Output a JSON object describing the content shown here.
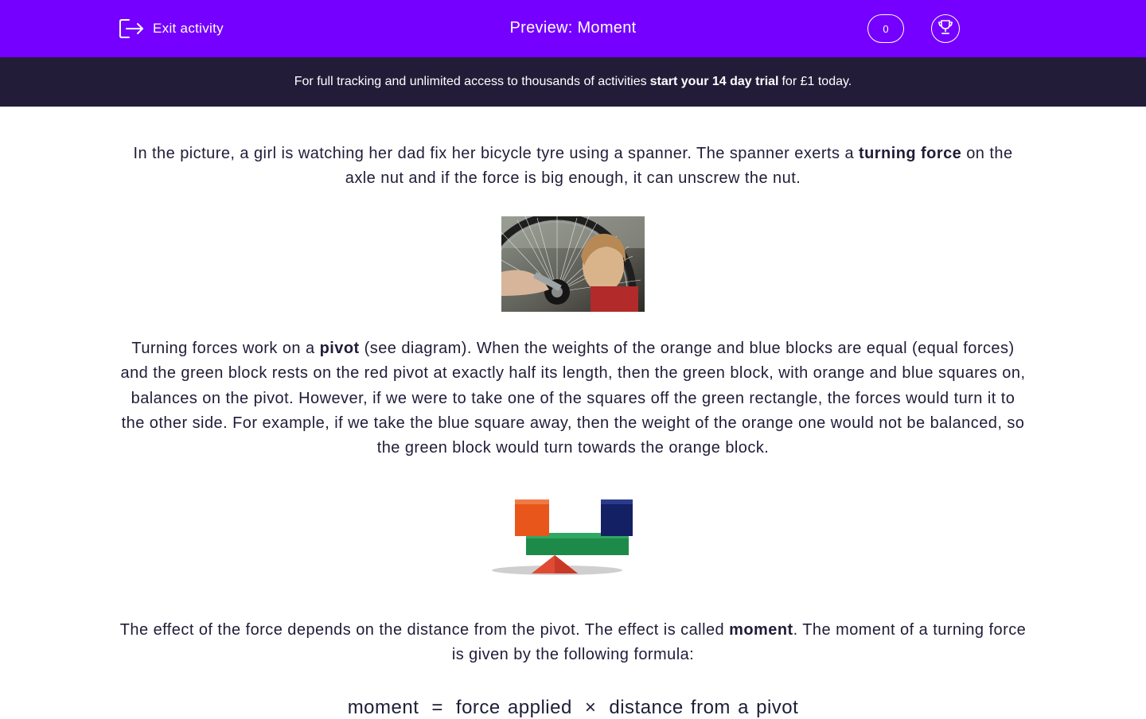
{
  "topbar": {
    "exit_label": "Exit activity",
    "title": "Preview: Moment",
    "score": "0",
    "background": "#7500ff"
  },
  "banner": {
    "text_before": "For full tracking and unlimited access to thousands of activities",
    "link_text": "start your 14 day trial",
    "text_after": "for £1 today.",
    "background": "#231c38"
  },
  "content": {
    "p1": {
      "a": "In the picture, a girl is watching her dad fix her bicycle tyre using a spanner. The spanner exerts a ",
      "bold": "turning force",
      "b": " on the axle nut and if the force is big enough, it can unscrew the nut."
    },
    "p2": {
      "a": "Turning forces work on a ",
      "bold": "pivot",
      "b": " (see diagram). When the weights of the orange and blue blocks are equal (equal forces) and the green block rests on the red pivot at exactly half its length, then the green block, with orange and blue squares on, balances on the pivot. However, if we were to take one of the squares off the green rectangle, the forces would turn it to the other side. For example, if we take the blue square away, then the weight of the orange one would not be balanced, so the green block would turn towards the orange block."
    },
    "p3": {
      "a": "The effect of the force depends on the distance from the pivot. The effect is called ",
      "bold": "moment",
      "b": ". The moment of a turning force is given by the following formula:"
    },
    "formula": {
      "lhs": "moment",
      "equals": "=",
      "term1": "force applied",
      "times": "×",
      "term2": "distance from a pivot"
    }
  },
  "icons": {
    "exit": "exit-icon",
    "trophy": "trophy-icon"
  }
}
